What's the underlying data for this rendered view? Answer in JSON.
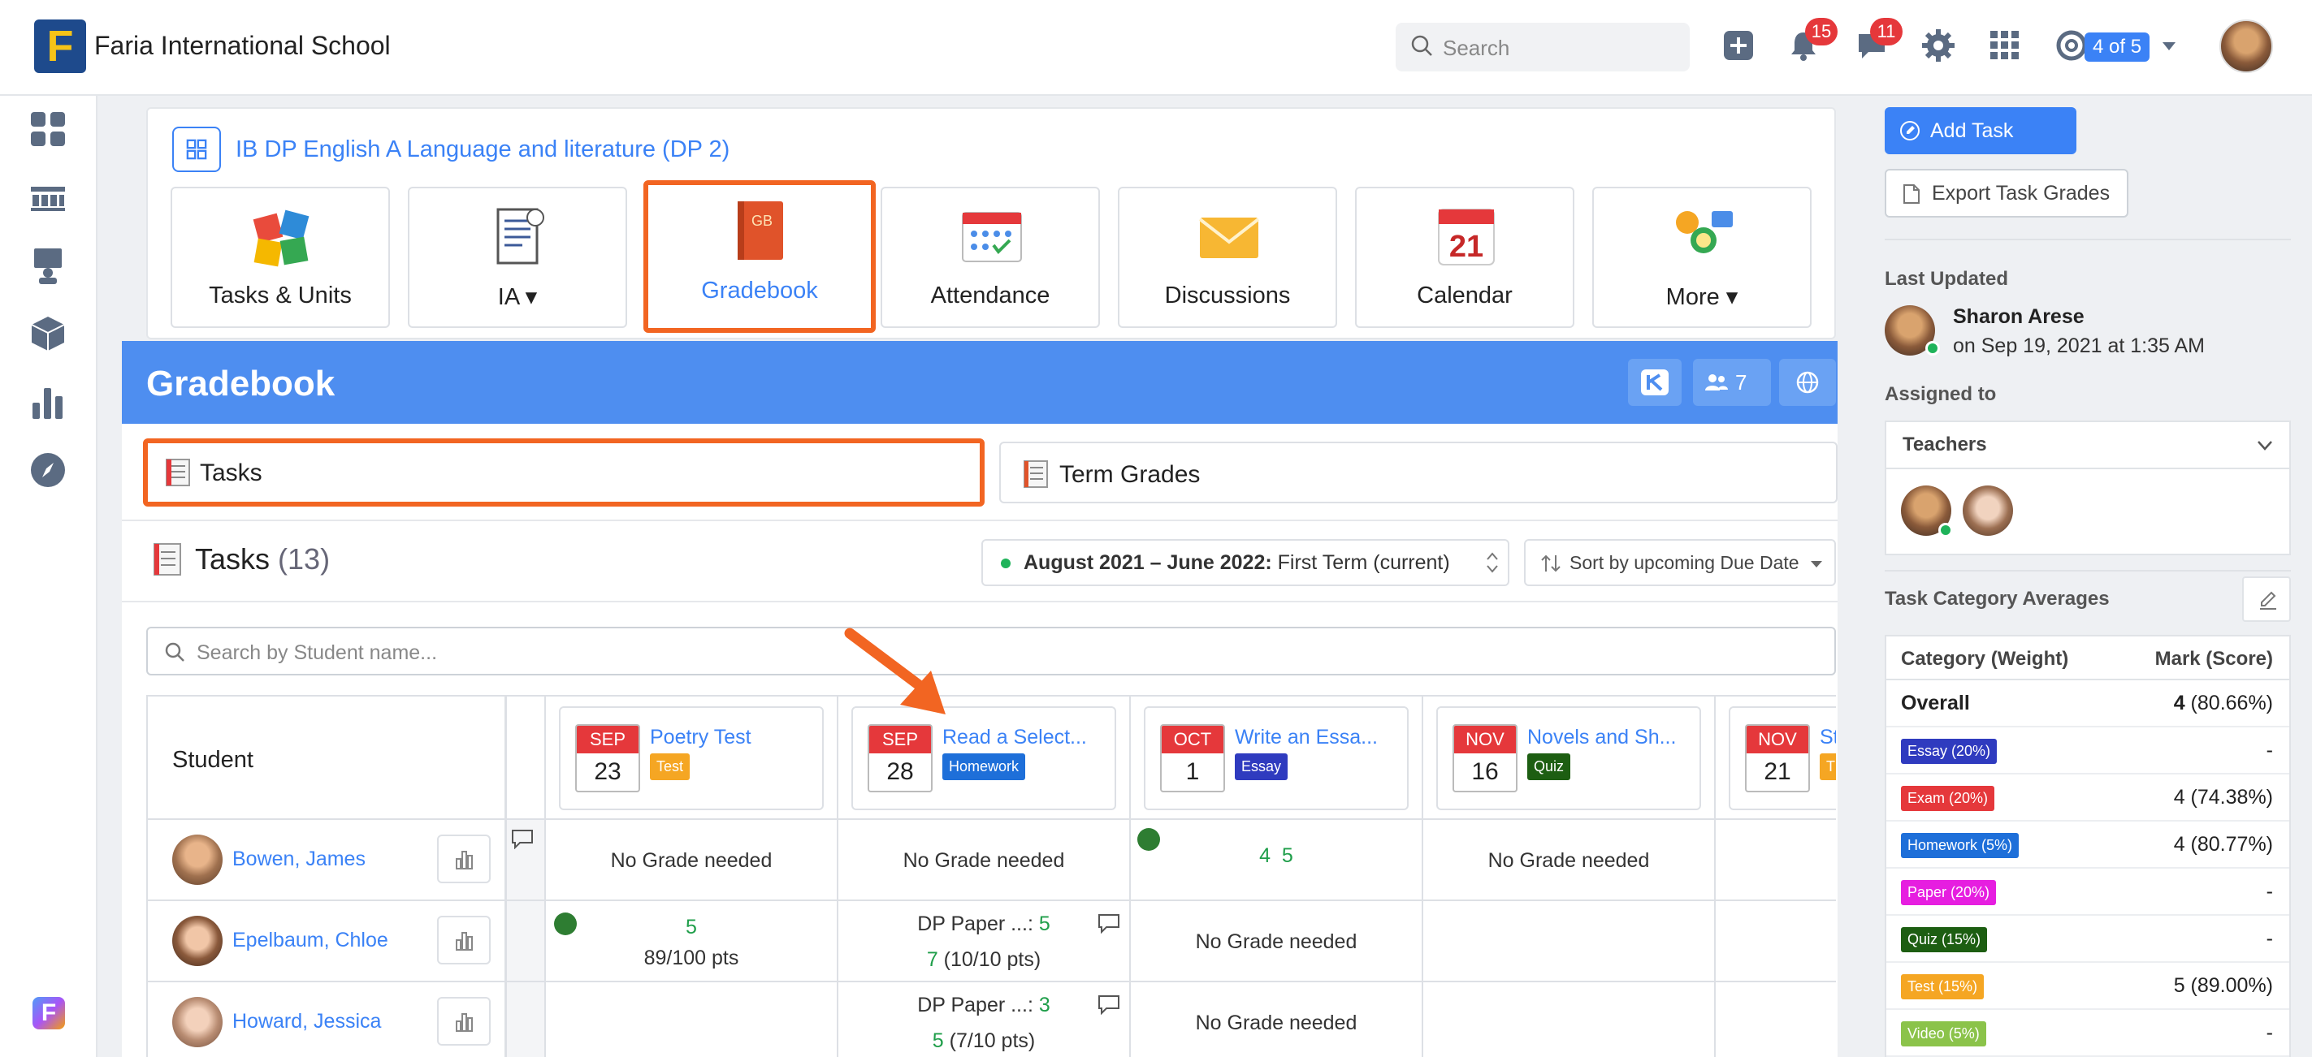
{
  "topbar": {
    "school_name": "Faria International School",
    "logo_letter": "F",
    "search_placeholder": "Search",
    "notifications_count": "15",
    "messages_count": "11",
    "role_label": "4 of 5"
  },
  "class_nav": {
    "class_title": "IB DP English A Language and literature (DP 2)",
    "tiles": [
      {
        "label": "Tasks & Units",
        "icon": "puzzle-icon"
      },
      {
        "label": "IA ▾",
        "icon": "document-icon"
      },
      {
        "label": "Gradebook",
        "icon": "gradebook-icon",
        "icon_text": "GB",
        "active": true
      },
      {
        "label": "Attendance",
        "icon": "attendance-icon"
      },
      {
        "label": "Discussions",
        "icon": "envelope-icon"
      },
      {
        "label": "Calendar",
        "icon": "calendar-icon",
        "icon_text": "21"
      },
      {
        "label": "More ▾",
        "icon": "more-icon"
      }
    ]
  },
  "gradebook": {
    "title": "Gradebook",
    "people_count": "7",
    "tabs": {
      "tasks": "Tasks",
      "term_grades": "Term Grades"
    },
    "tasks_heading": "Tasks",
    "tasks_count": "(13)",
    "term_bold": "August 2021 – June 2022:",
    "term_rest": " First Term (current)",
    "sort_label": "Sort by upcoming Due Date",
    "student_search_placeholder": "Search by Student name...",
    "student_header": "Student"
  },
  "tasks": [
    {
      "month": "SEP",
      "day": "23",
      "name": "Poetry Test",
      "category": "Test",
      "cat_color": "#f5a623"
    },
    {
      "month": "SEP",
      "day": "28",
      "name": "Read a Select...",
      "category": "Homework",
      "cat_color": "#1e6fd9"
    },
    {
      "month": "OCT",
      "day": "1",
      "name": "Write an Essa...",
      "category": "Essay",
      "cat_color": "#2f3bbf"
    },
    {
      "month": "NOV",
      "day": "16",
      "name": "Novels and Sh...",
      "category": "Quiz",
      "cat_color": "#1d5e12"
    },
    {
      "month": "NOV",
      "day": "21",
      "name": "St",
      "category": "T",
      "cat_color": "#f5a623"
    }
  ],
  "students": [
    {
      "name": "Bowen, James"
    },
    {
      "name": "Epelbaum, Chloe"
    },
    {
      "name": "Howard, Jessica"
    }
  ],
  "grades": {
    "r0": {
      "c0": "No Grade needed",
      "c1": "No Grade needed",
      "c2": "4  5",
      "c3": "No Grade needed"
    },
    "r1": {
      "c0a": "5",
      "c0b": "89/100 pts",
      "c1a": "DP Paper ...: ",
      "c1a_v": "5",
      "c1b_v": "7",
      "c1b": " (10/10 pts)",
      "c2": "No Grade needed"
    },
    "r2": {
      "c1a": "DP Paper ...: ",
      "c1a_v": "3",
      "c1b_v": "5",
      "c1b": " (7/10 pts)",
      "c2": "No Grade needed"
    }
  },
  "right_panel": {
    "add_task": "Add Task",
    "export_label": "Export Task Grades",
    "last_updated_label": "Last Updated",
    "updated_by": "Sharon Arese",
    "updated_on": "on Sep 19, 2021 at 1:35 AM",
    "assigned_to_label": "Assigned to",
    "teachers_label": "Teachers",
    "category_avg_label": "Task Category Averages",
    "col_category": "Category (Weight)",
    "col_mark": "Mark (Score)",
    "overall_label": "Overall",
    "overall_mark": "4",
    "overall_score": " (80.66%)",
    "categories": [
      {
        "name": "Essay (20%)",
        "color": "#2f3bbf",
        "mark": "-"
      },
      {
        "name": "Exam (20%)",
        "color": "#e5383b",
        "mark": "4 (74.38%)"
      },
      {
        "name": "Homework (5%)",
        "color": "#1e6fd9",
        "mark": "4 (80.77%)"
      },
      {
        "name": "Paper (20%)",
        "color": "#e61ee0",
        "mark": "-"
      },
      {
        "name": "Quiz (15%)",
        "color": "#1d5e12",
        "mark": "-"
      },
      {
        "name": "Test (15%)",
        "color": "#f5a623",
        "mark": "5 (89.00%)"
      },
      {
        "name": "Video (5%)",
        "color": "#8bc34a",
        "mark": "-"
      }
    ]
  }
}
